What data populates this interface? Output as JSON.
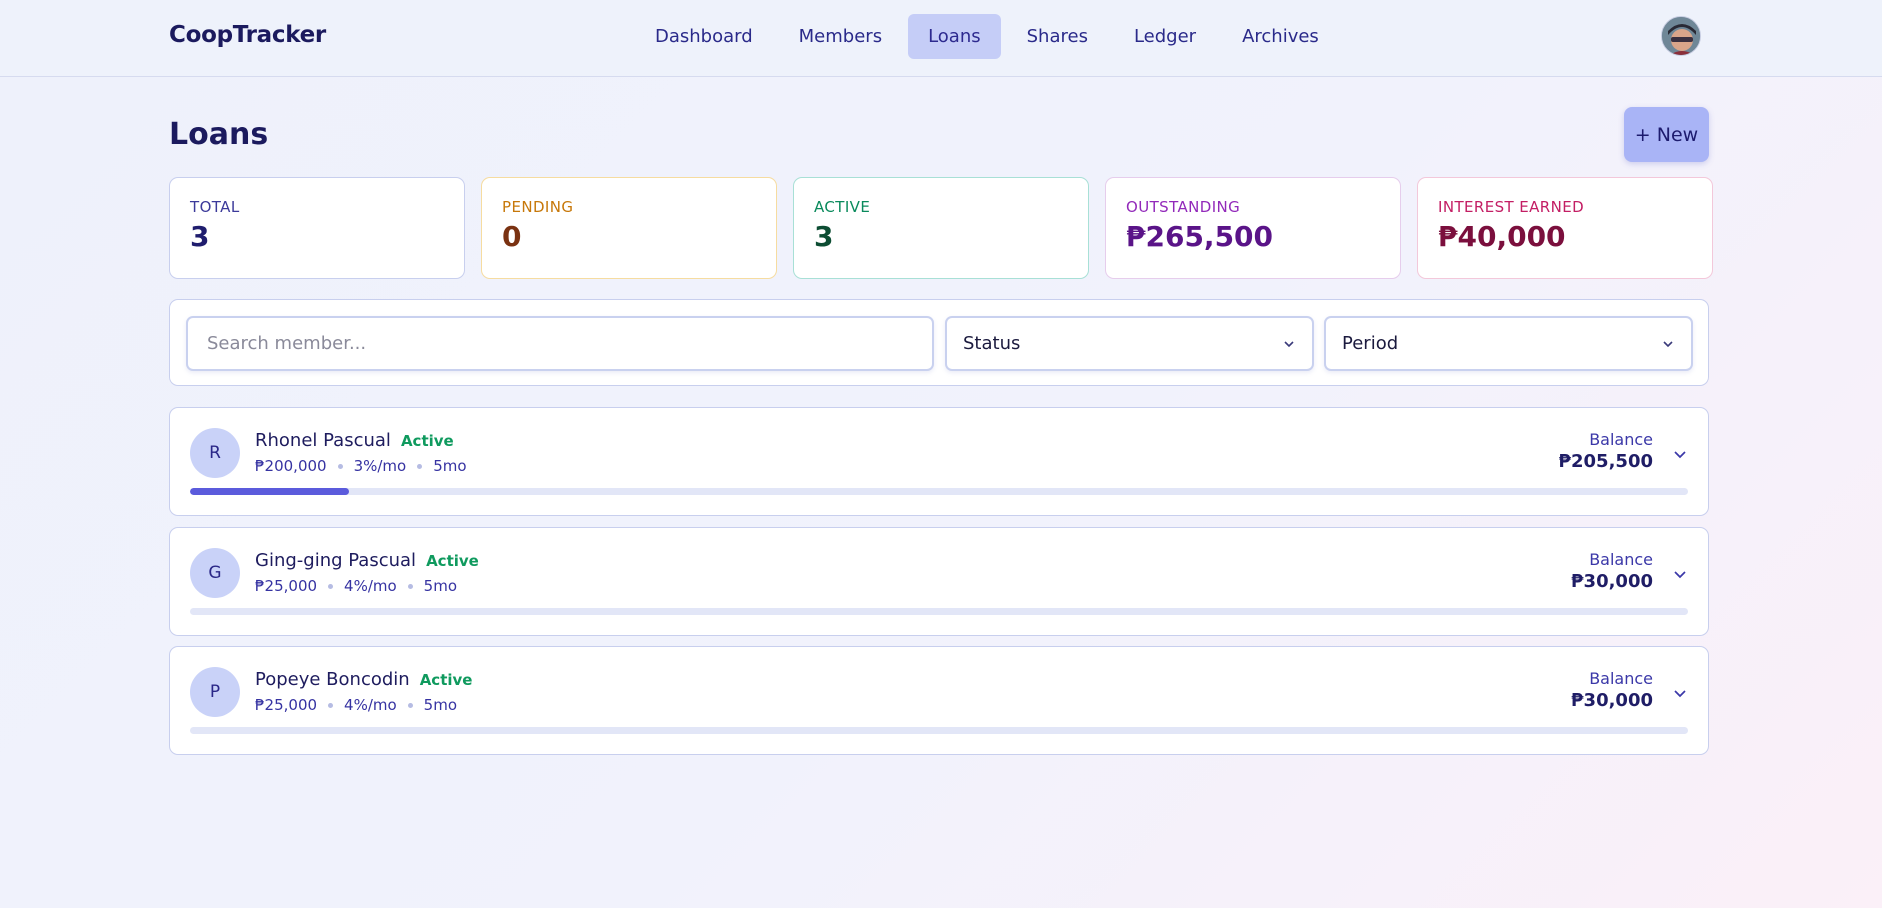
{
  "app": {
    "brand": "CoopTracker"
  },
  "nav": [
    {
      "label": "Dashboard",
      "active": false
    },
    {
      "label": "Members",
      "active": false
    },
    {
      "label": "Loans",
      "active": true
    },
    {
      "label": "Shares",
      "active": false
    },
    {
      "label": "Ledger",
      "active": false
    },
    {
      "label": "Archives",
      "active": false
    }
  ],
  "page": {
    "title": "Loans",
    "new_label": "+ New"
  },
  "stats": {
    "total": {
      "label": "TOTAL",
      "value": "3"
    },
    "pending": {
      "label": "PENDING",
      "value": "0"
    },
    "active": {
      "label": "ACTIVE",
      "value": "3"
    },
    "outstanding": {
      "label": "OUTSTANDING",
      "value": "₱265,500"
    },
    "interest": {
      "label": "INTEREST EARNED",
      "value": "₱40,000"
    }
  },
  "filters": {
    "search_placeholder": "Search member...",
    "status": "Status",
    "period": "Period"
  },
  "loans": [
    {
      "initial": "R",
      "name": "Rhonel Pascual",
      "status": "Active",
      "principal": "₱200,000",
      "rate": "3%/mo",
      "term": "5mo",
      "balance_label": "Balance",
      "balance": "₱205,500",
      "progress": 0.106
    },
    {
      "initial": "G",
      "name": "Ging-ging Pascual",
      "status": "Active",
      "principal": "₱25,000",
      "rate": "4%/mo",
      "term": "5mo",
      "balance_label": "Balance",
      "balance": "₱30,000",
      "progress": 0
    },
    {
      "initial": "P",
      "name": "Popeye Boncodin",
      "status": "Active",
      "principal": "₱25,000",
      "rate": "4%/mo",
      "term": "5mo",
      "balance_label": "Balance",
      "balance": "₱30,000",
      "progress": 0
    }
  ],
  "colors": {
    "accent": "#5b5bdc",
    "active_badge": "#0f9a5e",
    "nav_active_bg": "#c5cdf7"
  },
  "icons": {
    "select": "chevron-down-icon",
    "expand": "chevron-down-icon",
    "avatar": "user-avatar"
  }
}
